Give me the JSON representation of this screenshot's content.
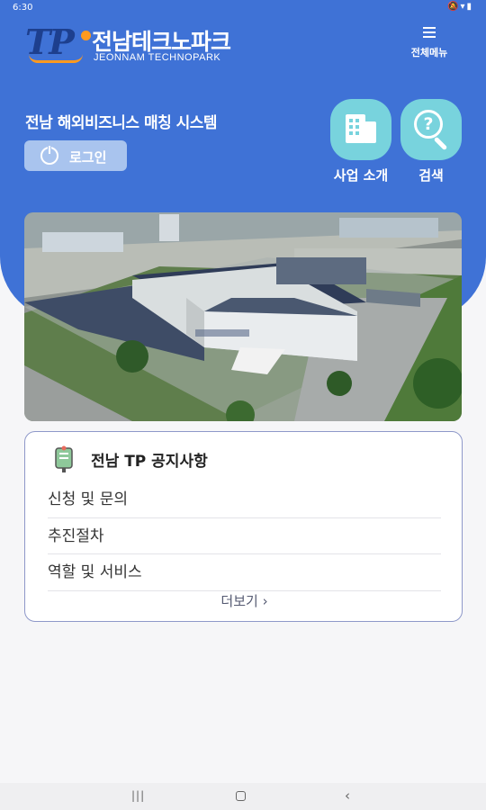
{
  "status_bar": {
    "time": "6:30",
    "icons": [
      "mute-icon",
      "wifi-icon",
      "battery-icon"
    ],
    "icon_glyphs": "🔕▾▮"
  },
  "header": {
    "logo": {
      "mark": "TP",
      "korean": "전남테크노파크",
      "english": "JEONNAM TECHNOPARK"
    },
    "menu": {
      "label": "전체메뉴",
      "icon": "hamburger-icon"
    },
    "system_title": "전남 해외비즈니스 매칭 시스템",
    "login": {
      "label": "로그인",
      "icon": "power-icon"
    },
    "quick_links": [
      {
        "label": "사업 소개",
        "icon": "building-icon"
      },
      {
        "label": "검색",
        "icon": "search-question-icon"
      }
    ]
  },
  "notice": {
    "title": "전남 TP 공지사항",
    "icon": "notice-board-icon",
    "items": [
      {
        "label": "신청 및 문의"
      },
      {
        "label": "추진절차"
      },
      {
        "label": "역할 및 서비스"
      }
    ],
    "more_label": "더보기 ›"
  },
  "nav_bar": {
    "recent": "|||",
    "back": "‹"
  },
  "colors": {
    "header_blue": "#3f72d6",
    "tile_teal": "#78d3dd",
    "login_button": "#a9c4ee",
    "card_border": "#8e98c9",
    "logo_orange": "#ff9a1f"
  }
}
